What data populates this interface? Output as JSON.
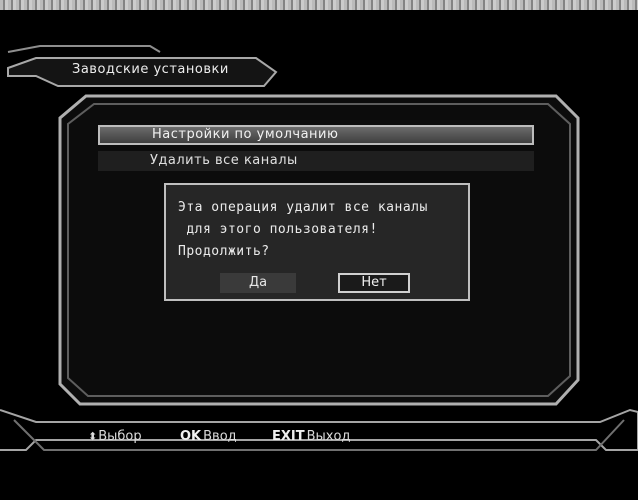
{
  "header": {
    "title": "Заводские установки"
  },
  "menu": {
    "items": [
      {
        "label": "Настройки по умолчанию",
        "selected": true
      },
      {
        "label": "Удалить все каналы",
        "selected": false
      }
    ]
  },
  "dialog": {
    "message": "Эта операция удалит все каналы\n для этого пользователя!\nПродолжить?",
    "yes_label": "Да",
    "no_label": "Нет",
    "focused": "Нет"
  },
  "footer": {
    "select_icon": "updown-arrows-icon",
    "select_glyph": "⬍",
    "select_label": "Выбор",
    "ok_key": "OK",
    "ok_label": "Ввод",
    "exit_key": "EXIT",
    "exit_label": "Выход"
  }
}
